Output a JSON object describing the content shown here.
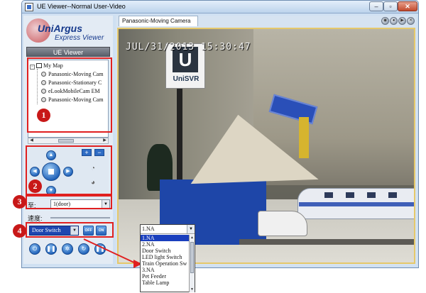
{
  "window": {
    "title": "UE Viewer--Normal User-Video",
    "controls": {
      "minimize": "–",
      "maximize": "▫",
      "close": "✕"
    }
  },
  "sidebar": {
    "logo_main": "UniArgus",
    "logo_sub": "Express Viewer",
    "viewer_button": "UE Viewer",
    "tree": {
      "root": "My Map",
      "root_expander": "−",
      "items": [
        {
          "label": "Panasonic-Moving Cam"
        },
        {
          "label": "Panasonic-Stationary C"
        },
        {
          "label": "eLookMobileCam EM"
        },
        {
          "label": "Panasonic-Moving Cam"
        }
      ]
    },
    "ptz": {
      "zoom_in": "+",
      "zoom_out": "−",
      "up": "▲",
      "down": "▼",
      "left": "◀",
      "right": "▶"
    },
    "preset": {
      "label": "至:",
      "value": "1(door)"
    },
    "speed": {
      "label": "速度:"
    },
    "switch": {
      "value": "Door Switch",
      "off": "OFF",
      "on": "ON"
    },
    "bottom_icons": [
      "power-icon",
      "pause-icon",
      "settings-icon",
      "refresh-icon",
      "stop-icon"
    ]
  },
  "video": {
    "tab_title": "Panasonic-Moving Camera",
    "timestamp": "JUL/31/2013  15:30:47",
    "sign_letter": "U",
    "sign_text": "UniSVR"
  },
  "annotations": [
    "1",
    "2",
    "3",
    "4"
  ],
  "dropdown": {
    "selected": "1.NA",
    "options": [
      "1.NA",
      "2.NA",
      "Door Switch",
      "LED light Switch",
      "Train Operation Sw",
      "3.NA",
      "Pet Feeder",
      "Table Lamp"
    ],
    "highlighted_index": 0
  },
  "colors": {
    "accent": "#1d5fb8",
    "annotation": "#e02020",
    "highlight": "#1a3fbd"
  }
}
